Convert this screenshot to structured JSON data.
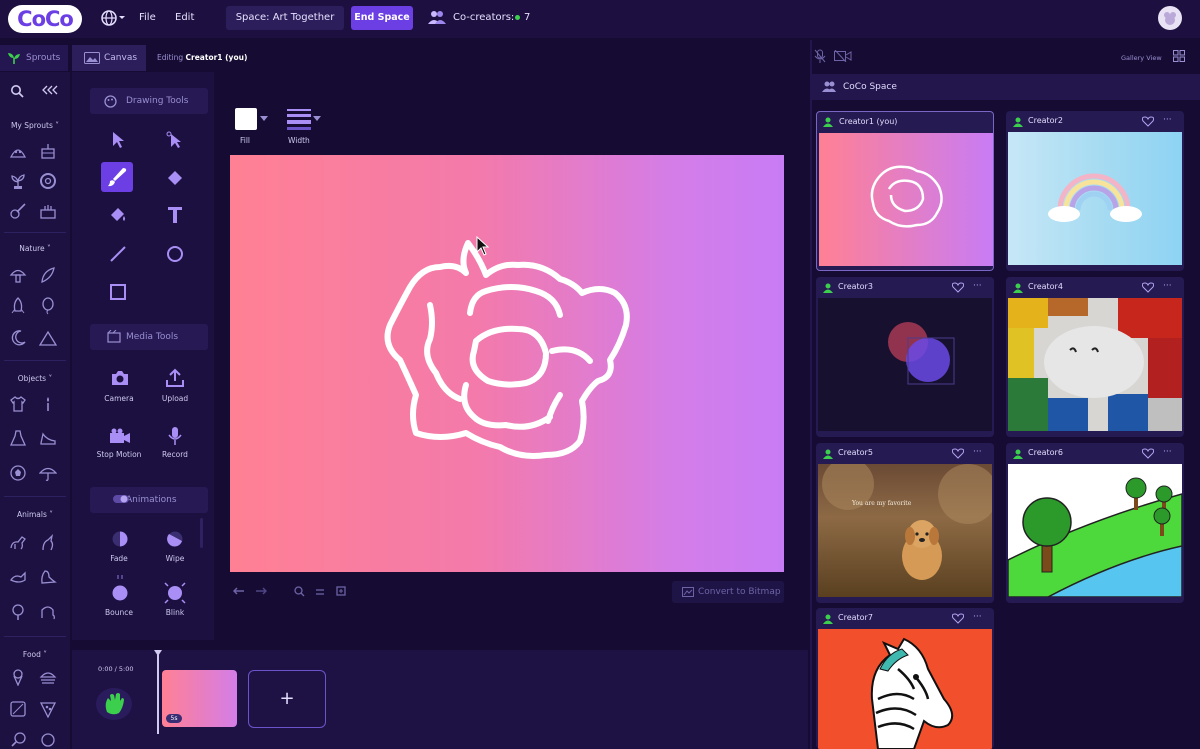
{
  "topbar": {
    "logo": "CoCo",
    "menu": [
      "File",
      "Edit"
    ],
    "space_label": "Space: Art Together",
    "end_space": "End Space",
    "cocreators_label": "Co-creators:",
    "cocreators_count": "7"
  },
  "tabs": {
    "sprouts": "Sprouts",
    "canvas": "Canvas",
    "editing_prefix": "Editing",
    "editing_name": "Creator1 (you)"
  },
  "sidebar": {
    "categories": [
      "My Sprouts",
      "Nature",
      "Objects",
      "Animals",
      "Food"
    ]
  },
  "tools": {
    "drawing_header": "Drawing Tools",
    "media_header": "Media Tools",
    "media": [
      "Camera",
      "Upload",
      "Stop Motion",
      "Record"
    ],
    "animations_header": "Animations",
    "animations": [
      "Fade",
      "Wipe",
      "Bounce",
      "Blink"
    ]
  },
  "props": {
    "fill": "Fill",
    "width": "Width"
  },
  "canvas": {
    "convert": "Convert to Bitmap",
    "gradient_start": "#ff8094",
    "gradient_end": "#c87cf5"
  },
  "timeline": {
    "time": "0:00 / 5:00",
    "frame_badge": "5s",
    "add": "+"
  },
  "right": {
    "gallery_view": "Gallery View",
    "space_title": "CoCo Space",
    "creators": [
      "Creator1 (you)",
      "Creator2",
      "Creator3",
      "Creator4",
      "Creator5",
      "Creator6",
      "Creator7"
    ],
    "creator5_caption": "You are my favorite"
  },
  "colors": {
    "accent": "#6b3fe3",
    "bg": "#160c33",
    "online": "#3ccf4e"
  }
}
